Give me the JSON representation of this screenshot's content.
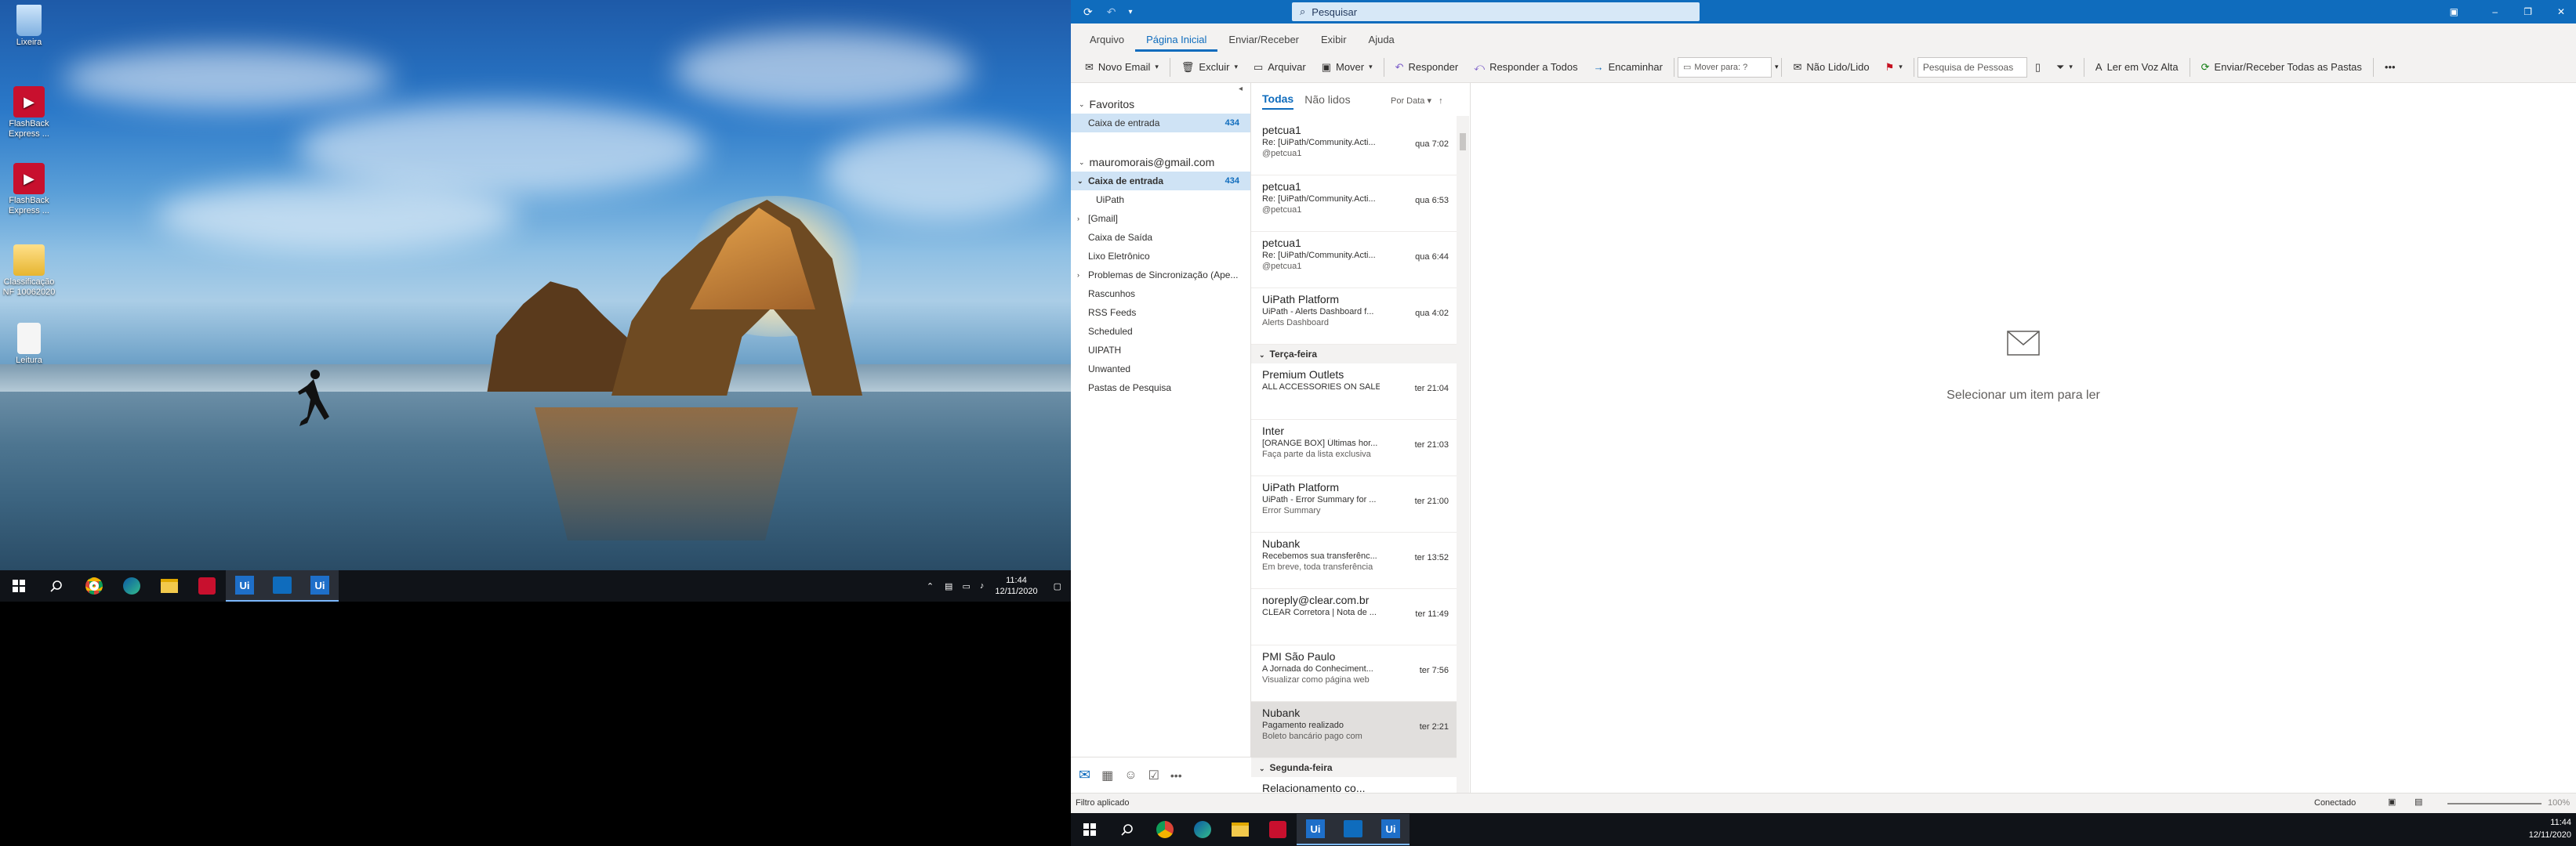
{
  "desktop": {
    "icons": [
      {
        "label": "Lixeira",
        "icon": "recycle-bin-icon",
        "color": "#9cc7ee"
      },
      {
        "label": "FlashBack Express ...",
        "icon": "flashback-icon",
        "color": "#c8102e"
      },
      {
        "label": "FlashBack Express ...",
        "icon": "flashback-icon",
        "color": "#c8102e"
      },
      {
        "label": "Classificação NF 10062020",
        "icon": "folder-icon",
        "color": "#f2c94c"
      },
      {
        "label": "Leitura",
        "icon": "document-icon",
        "color": "#f5f5f5"
      }
    ],
    "taskbar": {
      "apps": [
        "start-icon",
        "search-icon",
        "chrome-icon",
        "edge-icon",
        "file-explorer-icon",
        "flashback-icon",
        "uipath-studio-icon",
        "outlook-icon",
        "uipath-icon"
      ],
      "time": "11:44",
      "date": "12/11/2020"
    }
  },
  "outlook": {
    "search_placeholder": "Pesquisar",
    "menu": [
      "Arquivo",
      "Página Inicial",
      "Enviar/Receber",
      "Exibir",
      "Ajuda"
    ],
    "ribbon": {
      "new_email": "Novo Email",
      "delete": "Excluir",
      "archive": "Arquivar",
      "move": "Mover",
      "reply": "Responder",
      "reply_all": "Responder a Todos",
      "forward": "Encaminhar",
      "move_to": "Mover para: ?",
      "unread_read": "Não Lido/Lido",
      "people_search": "Pesquisa de Pessoas",
      "read_aloud": "Ler em Voz Alta",
      "send_receive_all": "Enviar/Receber Todas as Pastas"
    },
    "favorites_label": "Favoritos",
    "favorites": [
      {
        "name": "Caixa de entrada",
        "count": "434"
      }
    ],
    "account": "mauromorais@gmail.com",
    "folders": [
      {
        "name": "Caixa de entrada",
        "count": "434"
      },
      {
        "name": "UiPath"
      },
      {
        "name": "[Gmail]"
      },
      {
        "name": "Caixa de Saída"
      },
      {
        "name": "Lixo Eletrônico"
      },
      {
        "name": "Problemas de Sincronização (Ape..."
      },
      {
        "name": "Rascunhos"
      },
      {
        "name": "RSS Feeds"
      },
      {
        "name": "Scheduled"
      },
      {
        "name": "UIPATH"
      },
      {
        "name": "Unwanted"
      },
      {
        "name": "Pastas de Pesquisa"
      }
    ],
    "list_tabs": {
      "all": "Todas",
      "unread": "Não lidos",
      "sort": "Por Data"
    },
    "messages_today": [
      {
        "from": "petcua1",
        "subject": "Re: [UiPath/Community.Acti...",
        "preview": "@petcua1",
        "time": "qua 7:02"
      },
      {
        "from": "petcua1",
        "subject": "Re: [UiPath/Community.Acti...",
        "preview": "@petcua1",
        "time": "qua 6:53"
      },
      {
        "from": "petcua1",
        "subject": "Re: [UiPath/Community.Acti...",
        "preview": "@petcua1",
        "time": "qua 6:44"
      },
      {
        "from": "UiPath Platform",
        "subject": "UiPath - Alerts Dashboard f...",
        "preview": "Alerts Dashboard",
        "time": "qua 4:02"
      }
    ],
    "group_tuesday": "Terça-feira",
    "messages_tuesday": [
      {
        "from": "Premium Outlets",
        "subject": "ALL ACCESSORIES ON SALE!...",
        "preview": "",
        "time": "ter 21:04"
      },
      {
        "from": "Inter",
        "subject": "[ORANGE BOX] Últimas hor...",
        "preview": "Faça parte da lista exclusiva",
        "time": "ter 21:03"
      },
      {
        "from": "UiPath Platform",
        "subject": "UiPath - Error Summary for ...",
        "preview": "Error Summary",
        "time": "ter 21:00"
      },
      {
        "from": "Nubank",
        "subject": "Recebemos sua transferênc...",
        "preview": "Em breve, toda transferência",
        "time": "ter 13:52"
      },
      {
        "from": "noreply@clear.com.br",
        "subject": "CLEAR Corretora | Nota de ...",
        "preview": "",
        "time": "ter 11:49"
      },
      {
        "from": "PMI São Paulo",
        "subject": "A Jornada do Conheciment...",
        "preview": "Visualizar como página web",
        "time": "ter 7:56"
      },
      {
        "from": "Nubank",
        "subject": "Pagamento realizado",
        "preview": "Boleto bancário pago com",
        "time": "ter 2:21"
      }
    ],
    "group_monday": "Segunda-feira",
    "messages_monday": [
      {
        "from": "Relacionamento co...",
        "subject": "",
        "preview": "",
        "time": ""
      }
    ],
    "reading_pane": "Selecionar um item para ler",
    "status_left": "Filtro aplicado",
    "status_right": "Conectado",
    "zoom": "100%",
    "taskbar": {
      "time": "11:44",
      "date": "12/11/2020"
    },
    "accent": "#0f6cbd"
  }
}
